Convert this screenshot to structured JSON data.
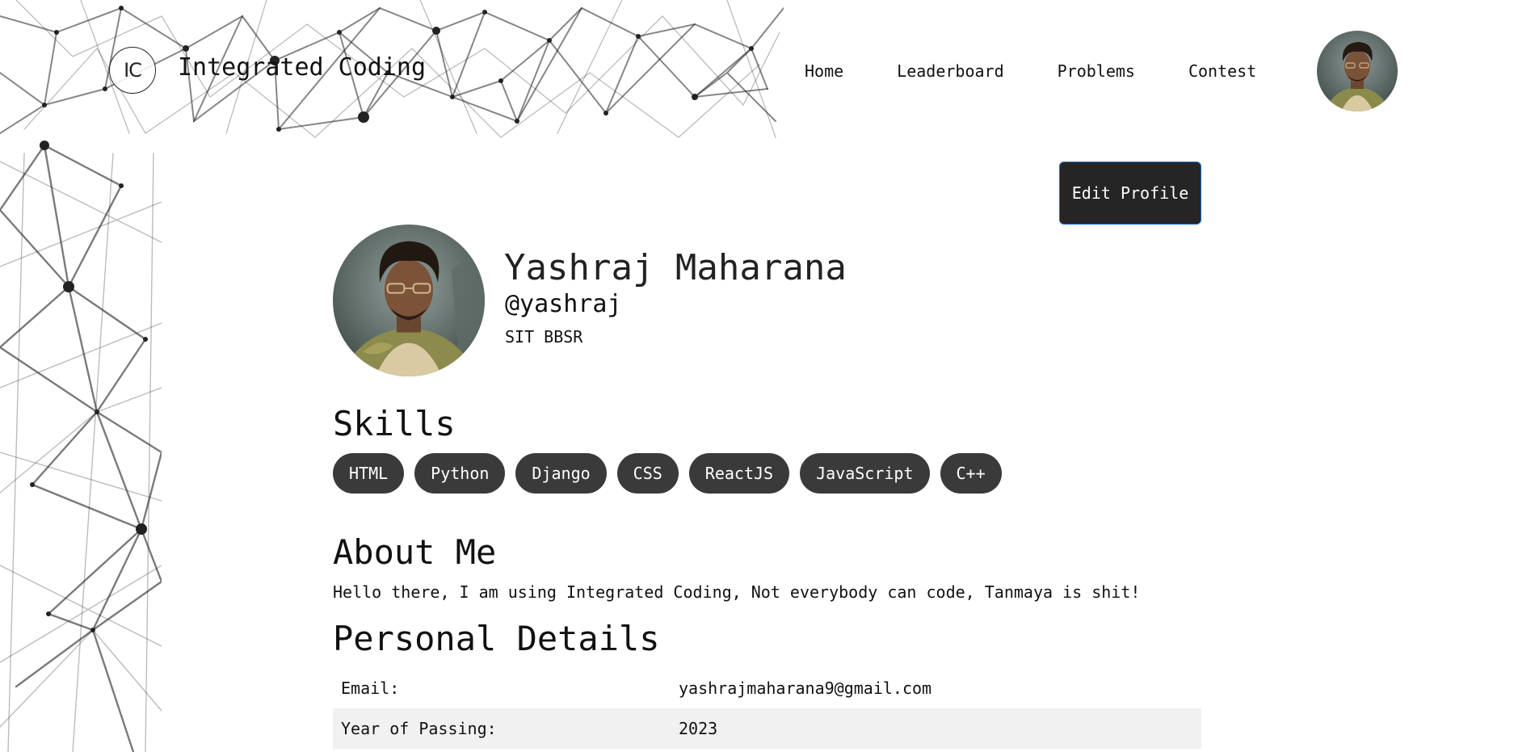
{
  "brand": {
    "logo_text": "IC",
    "name": "Integrated Coding"
  },
  "nav": {
    "links": [
      "Home",
      "Leaderboard",
      "Problems",
      "Contest"
    ]
  },
  "profile": {
    "edit_button": "Edit Profile",
    "name": "Yashraj Maharana",
    "handle": "@yashraj",
    "college": "SIT BBSR"
  },
  "skills": {
    "title": "Skills",
    "items": [
      "HTML",
      "Python",
      "Django",
      "CSS",
      "ReactJS",
      "JavaScript",
      "C++"
    ]
  },
  "about": {
    "title": "About Me",
    "text": "Hello there, I am using Integrated Coding, Not everybody can code, Tanmaya is shit!"
  },
  "personal": {
    "title": "Personal Details",
    "rows": [
      {
        "label": "Email:",
        "value": "yashrajmaharana9@gmail.com"
      },
      {
        "label": "Year of Passing:",
        "value": "2023"
      }
    ]
  },
  "colors": {
    "chip_bg": "#3a3a3a",
    "button_bg": "#252525",
    "button_border": "#1a6fd1",
    "row_alt": "#f1f1f1"
  }
}
